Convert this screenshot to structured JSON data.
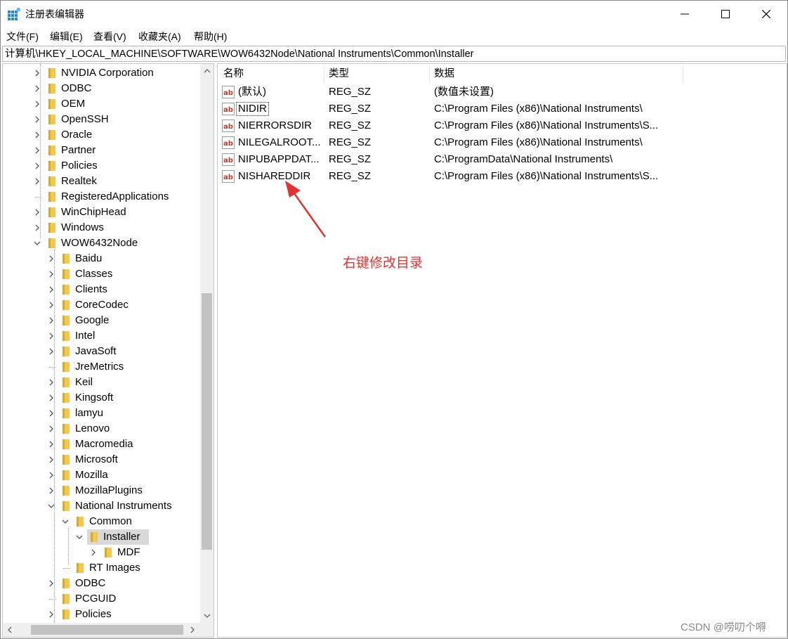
{
  "window": {
    "title": "注册表编辑器"
  },
  "menu": [
    "文件(F)",
    "编辑(E)",
    "查看(V)",
    "收藏夹(A)",
    "帮助(H)"
  ],
  "address": "计算机\\HKEY_LOCAL_MACHINE\\SOFTWARE\\WOW6432Node\\National Instruments\\Common\\Installer",
  "tree": [
    {
      "label": "NVIDIA Corporation",
      "level": 0,
      "expander": "collapsed"
    },
    {
      "label": "ODBC",
      "level": 0,
      "expander": "collapsed"
    },
    {
      "label": "OEM",
      "level": 0,
      "expander": "collapsed"
    },
    {
      "label": "OpenSSH",
      "level": 0,
      "expander": "collapsed"
    },
    {
      "label": "Oracle",
      "level": 0,
      "expander": "collapsed"
    },
    {
      "label": "Partner",
      "level": 0,
      "expander": "collapsed"
    },
    {
      "label": "Policies",
      "level": 0,
      "expander": "collapsed"
    },
    {
      "label": "Realtek",
      "level": 0,
      "expander": "collapsed"
    },
    {
      "label": "RegisteredApplications",
      "level": 0,
      "expander": "none"
    },
    {
      "label": "WinChipHead",
      "level": 0,
      "expander": "collapsed"
    },
    {
      "label": "Windows",
      "level": 0,
      "expander": "collapsed"
    },
    {
      "label": "WOW6432Node",
      "level": 0,
      "expander": "expanded"
    },
    {
      "label": "Baidu",
      "level": 1,
      "expander": "collapsed"
    },
    {
      "label": "Classes",
      "level": 1,
      "expander": "collapsed"
    },
    {
      "label": "Clients",
      "level": 1,
      "expander": "collapsed"
    },
    {
      "label": "CoreCodec",
      "level": 1,
      "expander": "collapsed"
    },
    {
      "label": "Google",
      "level": 1,
      "expander": "collapsed"
    },
    {
      "label": "Intel",
      "level": 1,
      "expander": "collapsed"
    },
    {
      "label": "JavaSoft",
      "level": 1,
      "expander": "collapsed"
    },
    {
      "label": "JreMetrics",
      "level": 1,
      "expander": "none"
    },
    {
      "label": "Keil",
      "level": 1,
      "expander": "collapsed"
    },
    {
      "label": "Kingsoft",
      "level": 1,
      "expander": "collapsed"
    },
    {
      "label": "lamyu",
      "level": 1,
      "expander": "collapsed"
    },
    {
      "label": "Lenovo",
      "level": 1,
      "expander": "collapsed"
    },
    {
      "label": "Macromedia",
      "level": 1,
      "expander": "collapsed"
    },
    {
      "label": "Microsoft",
      "level": 1,
      "expander": "collapsed"
    },
    {
      "label": "Mozilla",
      "level": 1,
      "expander": "collapsed"
    },
    {
      "label": "MozillaPlugins",
      "level": 1,
      "expander": "collapsed"
    },
    {
      "label": "National Instruments",
      "level": 1,
      "expander": "expanded"
    },
    {
      "label": "Common",
      "level": 2,
      "expander": "expanded"
    },
    {
      "label": "Installer",
      "level": 3,
      "expander": "expanded",
      "selected": true
    },
    {
      "label": "MDF",
      "level": 4,
      "expander": "collapsed"
    },
    {
      "label": "RT Images",
      "level": 2,
      "expander": "none"
    },
    {
      "label": "ODBC",
      "level": 1,
      "expander": "collapsed"
    },
    {
      "label": "PCGUID",
      "level": 1,
      "expander": "none"
    },
    {
      "label": "Policies",
      "level": 1,
      "expander": "collapsed"
    }
  ],
  "list": {
    "headers": [
      "名称",
      "类型",
      "数据"
    ],
    "rows": [
      {
        "name": "(默认)",
        "type": "REG_SZ",
        "data": "(数值未设置)"
      },
      {
        "name": "NIDIR",
        "type": "REG_SZ",
        "data": "C:\\Program Files (x86)\\National Instruments\\",
        "focused": true
      },
      {
        "name": "NIERRORSDIR",
        "type": "REG_SZ",
        "data": "C:\\Program Files (x86)\\National Instruments\\S..."
      },
      {
        "name": "NILEGALROOT...",
        "type": "REG_SZ",
        "data": "C:\\Program Files (x86)\\National Instruments\\"
      },
      {
        "name": "NIPUBAPPDAT...",
        "type": "REG_SZ",
        "data": "C:\\ProgramData\\National Instruments\\"
      },
      {
        "name": "NISHAREDDIR",
        "type": "REG_SZ",
        "data": "C:\\Program Files (x86)\\National Instruments\\S..."
      }
    ]
  },
  "annotation": {
    "text": "右键修改目录",
    "color": "#e03434"
  },
  "watermark": "CSDN @唠叨个嘚",
  "colors": {
    "folder": "#f2c94c",
    "selection": "#d9d9d9",
    "scroll_thumb": "#c2c2c2"
  }
}
